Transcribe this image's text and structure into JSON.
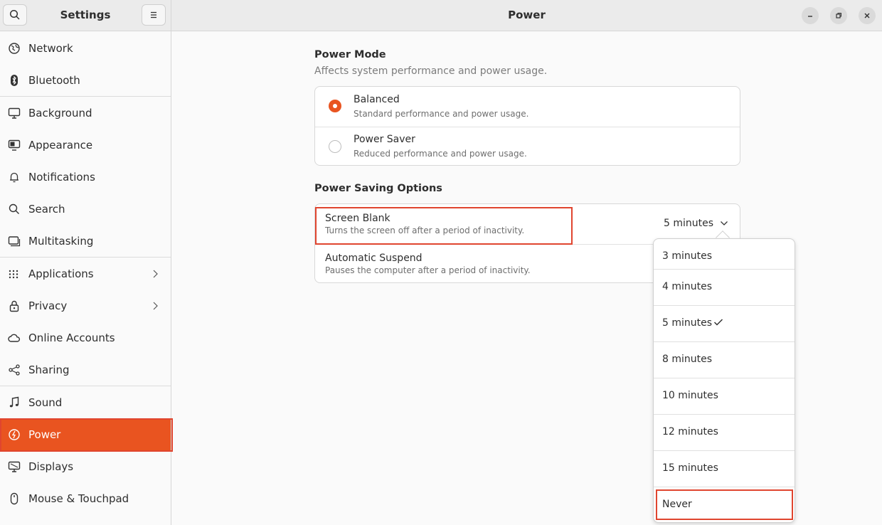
{
  "sidebar": {
    "title": "Settings",
    "items": [
      {
        "label": "Network",
        "icon": "network-icon"
      },
      {
        "label": "Bluetooth",
        "icon": "bluetooth-icon"
      },
      {
        "label": "Background",
        "icon": "background-icon"
      },
      {
        "label": "Appearance",
        "icon": "appearance-icon"
      },
      {
        "label": "Notifications",
        "icon": "bell-icon"
      },
      {
        "label": "Search",
        "icon": "search-icon"
      },
      {
        "label": "Multitasking",
        "icon": "multitasking-icon"
      },
      {
        "label": "Applications",
        "icon": "grid-icon"
      },
      {
        "label": "Privacy",
        "icon": "lock-icon"
      },
      {
        "label": "Online Accounts",
        "icon": "cloud-icon"
      },
      {
        "label": "Sharing",
        "icon": "share-icon"
      },
      {
        "label": "Sound",
        "icon": "music-note-icon"
      },
      {
        "label": "Power",
        "icon": "power-icon"
      },
      {
        "label": "Displays",
        "icon": "display-icon"
      },
      {
        "label": "Mouse & Touchpad",
        "icon": "mouse-icon"
      }
    ]
  },
  "header": {
    "title": "Power"
  },
  "power_mode": {
    "title": "Power Mode",
    "subtitle": "Affects system performance and power usage.",
    "options": [
      {
        "title": "Balanced",
        "subtitle": "Standard performance and power usage.",
        "selected": true
      },
      {
        "title": "Power Saver",
        "subtitle": "Reduced performance and power usage.",
        "selected": false
      }
    ]
  },
  "power_saving": {
    "title": "Power Saving Options",
    "screen_blank": {
      "title": "Screen Blank",
      "subtitle": "Turns the screen off after a period of inactivity.",
      "value": "5 minutes"
    },
    "automatic_suspend": {
      "title": "Automatic Suspend",
      "subtitle": "Pauses the computer after a period of inactivity."
    }
  },
  "dropdown": {
    "options": [
      "3 minutes",
      "4 minutes",
      "5 minutes",
      "8 minutes",
      "10 minutes",
      "12 minutes",
      "15 minutes",
      "Never"
    ],
    "selected": "5 minutes"
  },
  "colors": {
    "accent": "#e95420",
    "highlight": "#e0452f"
  }
}
